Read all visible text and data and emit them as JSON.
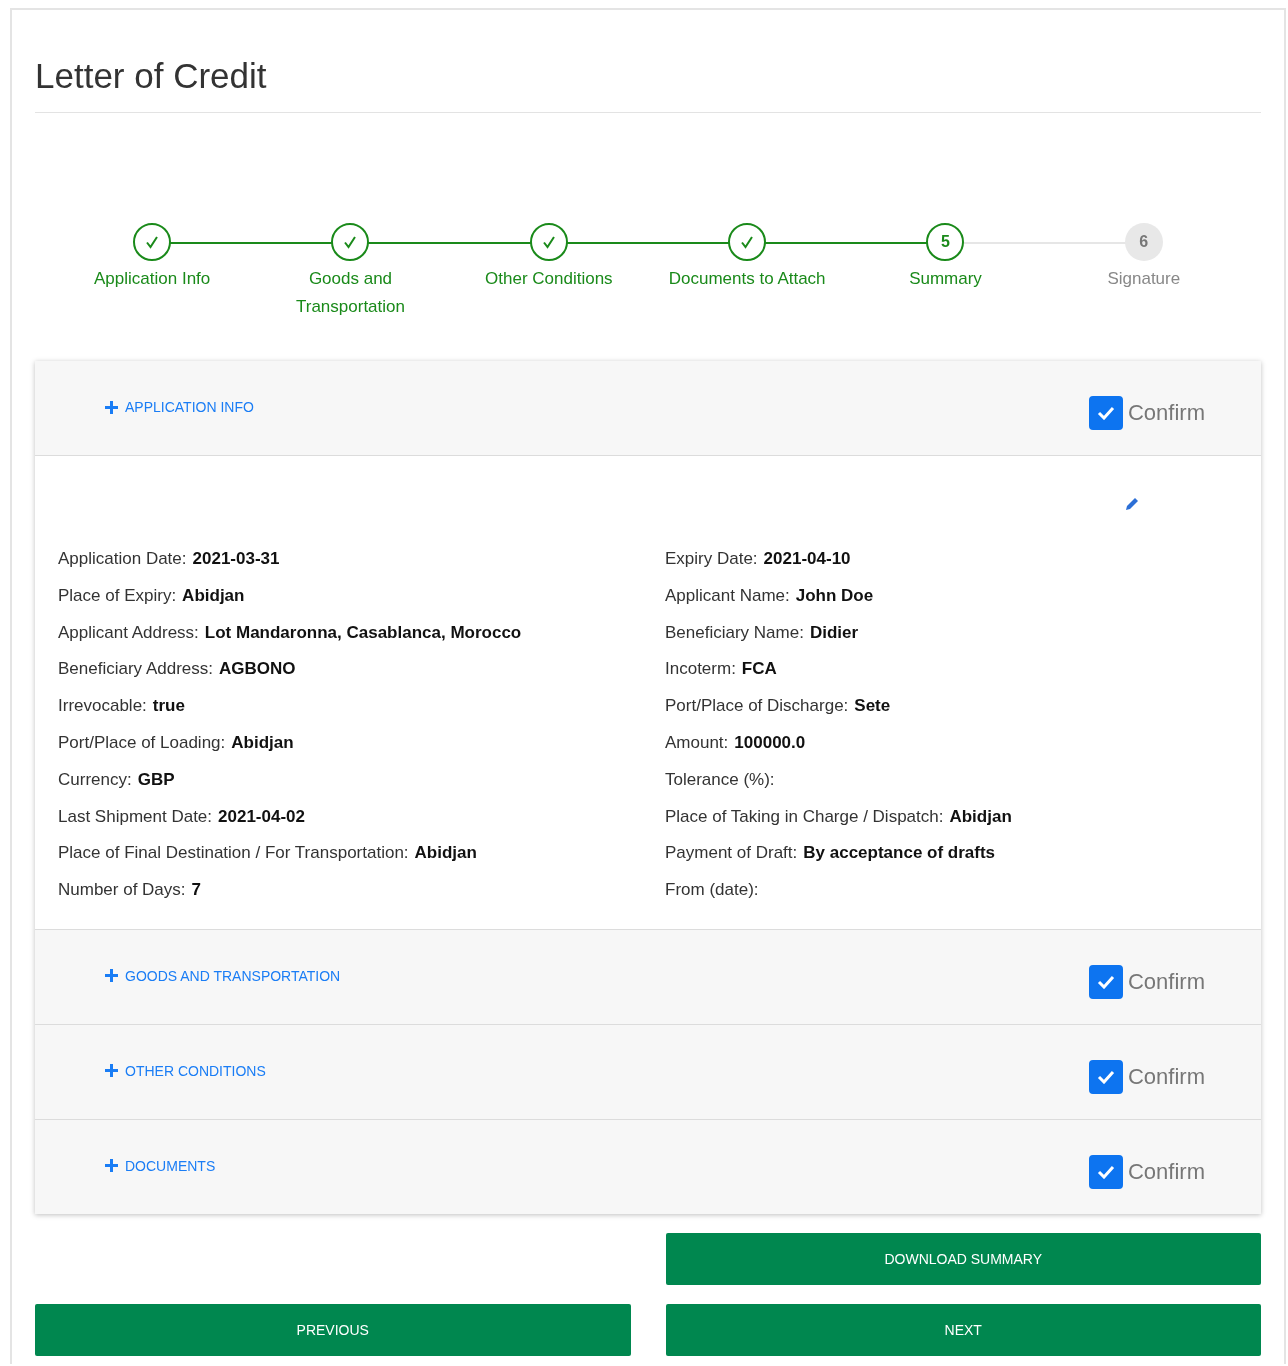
{
  "page_title": "Letter of Credit",
  "steps": [
    {
      "label": "Application Info",
      "completed": true,
      "selected": false
    },
    {
      "label": "Goods and Transportation",
      "completed": true,
      "selected": false
    },
    {
      "label": "Other Conditions",
      "completed": true,
      "selected": false
    },
    {
      "label": "Documents to Attach",
      "completed": true,
      "selected": false
    },
    {
      "label": "Summary",
      "completed": false,
      "selected": true,
      "number": "5"
    },
    {
      "label": "Signature",
      "completed": false,
      "selected": false,
      "number": "6"
    }
  ],
  "sections": [
    {
      "title": "APPLICATION INFO",
      "expanded": true,
      "confirmed": true,
      "confirm_label": "Confirm",
      "fields_left": [
        {
          "label": "Application Date:",
          "value": "2021-03-31"
        },
        {
          "label": "Place of Expiry:",
          "value": "Abidjan"
        },
        {
          "label": "Applicant Address:",
          "value": "Lot Mandaronna, Casablanca, Morocco"
        },
        {
          "label": "Beneficiary Address:",
          "value": "AGBONO"
        },
        {
          "label": "Irrevocable:",
          "value": "true"
        },
        {
          "label": "Port/Place of Loading:",
          "value": "Abidjan"
        },
        {
          "label": "Currency:",
          "value": "GBP"
        },
        {
          "label": "Last Shipment Date:",
          "value": "2021-04-02"
        },
        {
          "label": "Place of Final Destination / For Transportation:",
          "value": "Abidjan"
        },
        {
          "label": "Number of Days:",
          "value": "7"
        }
      ],
      "fields_right": [
        {
          "label": "Expiry Date:",
          "value": "2021-04-10"
        },
        {
          "label": "Applicant Name:",
          "value": "John Doe"
        },
        {
          "label": "Beneficiary Name:",
          "value": "Didier"
        },
        {
          "label": "Incoterm:",
          "value": "FCA"
        },
        {
          "label": "Port/Place of Discharge:",
          "value": "Sete"
        },
        {
          "label": "Amount:",
          "value": "100000.0"
        },
        {
          "label": "Tolerance (%):"
        },
        {
          "label": "Place of Taking in Charge / Dispatch:",
          "value": "Abidjan"
        },
        {
          "label": "Payment of Draft:",
          "value": "By acceptance of drafts"
        },
        {
          "label": "From (date):"
        }
      ]
    },
    {
      "title": "GOODS AND TRANSPORTATION",
      "expanded": false,
      "confirmed": true,
      "confirm_label": "Confirm"
    },
    {
      "title": "OTHER CONDITIONS",
      "expanded": false,
      "confirmed": true,
      "confirm_label": "Confirm"
    },
    {
      "title": "DOCUMENTS",
      "expanded": false,
      "confirmed": true,
      "confirm_label": "Confirm"
    }
  ],
  "buttons": {
    "download": "DOWNLOAD SUMMARY",
    "previous": "PREVIOUS",
    "next": "NEXT"
  }
}
